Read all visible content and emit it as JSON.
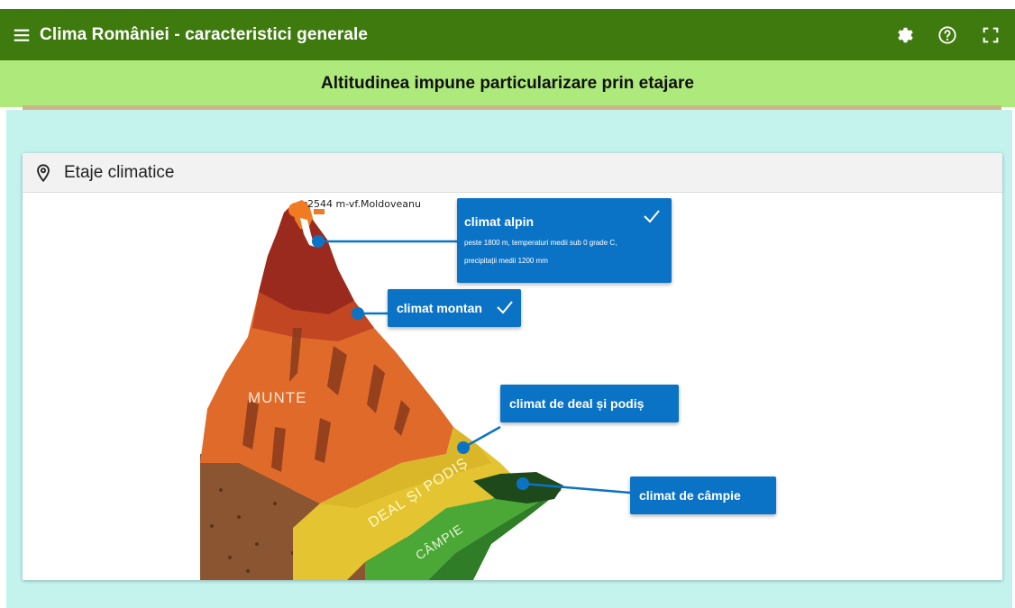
{
  "app": {
    "title": "Clima României - caracteristici generale",
    "subtitle": "Altitudinea impune particularizare prin etajare"
  },
  "icons": {
    "menu": "hamburger-menu-icon",
    "settings": "gear-icon",
    "help": "help-circle-icon",
    "fullscreen": "fullscreen-icon",
    "pin": "map-pin-icon",
    "check": "check-icon"
  },
  "colors": {
    "topbar": "#3f7a0e",
    "subheader": "#ade97b",
    "workspace": "#c4f3ee",
    "tooltip": "#0b73c6"
  },
  "panel": {
    "title": "Etaje climatice"
  },
  "illustration": {
    "peak_label": "2544 m-vf.Moldoveanu",
    "zones": {
      "munte": "MUNTE",
      "deal": "DEAL ȘI PODIȘ",
      "campie": "CÂMPIE"
    }
  },
  "hotspots": [
    {
      "name": "climat alpin",
      "checked": true,
      "desc_line1": "peste 1800 m, temperaturi medii sub 0 grade C,",
      "desc_line2": "precipitații medii 1200 mm"
    },
    {
      "name": "climat montan",
      "checked": true
    },
    {
      "name": "climat de deal și podiș",
      "checked": false
    },
    {
      "name": "climat de câmpie",
      "checked": false
    }
  ]
}
